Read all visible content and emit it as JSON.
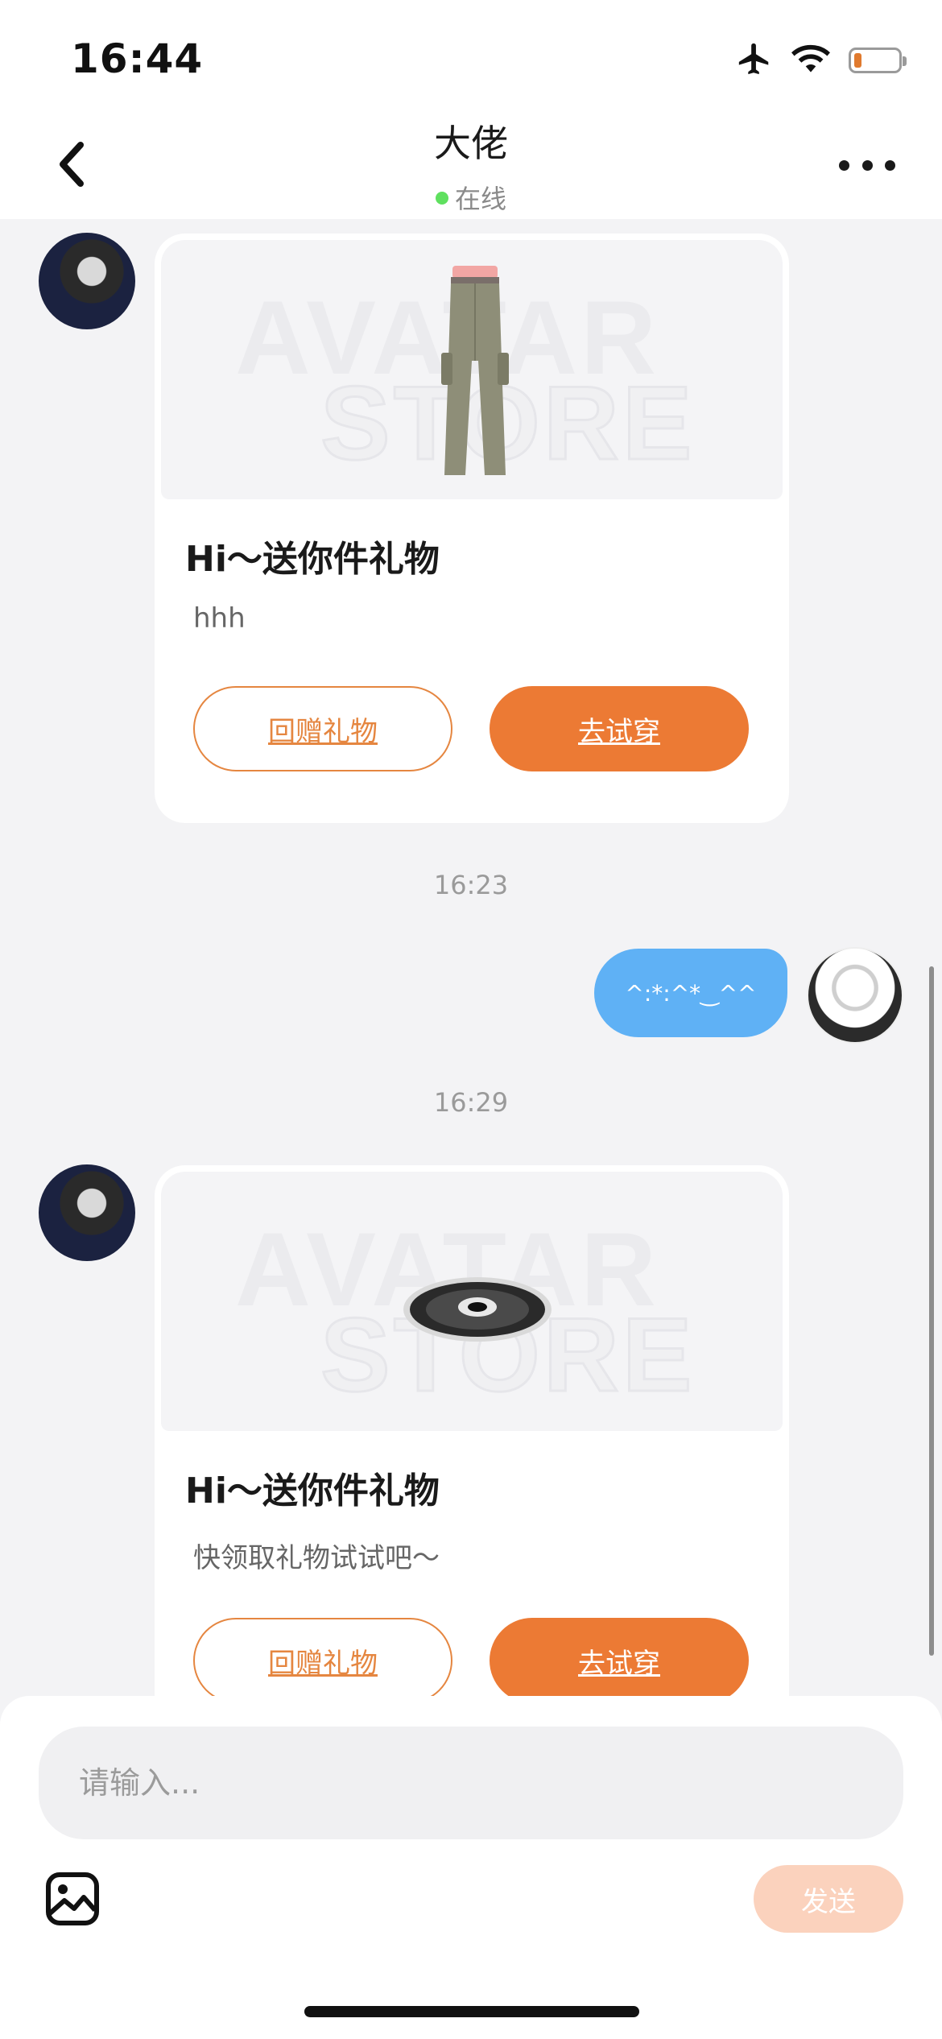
{
  "status_bar": {
    "time": "16:44",
    "battery_level": 0.18
  },
  "header": {
    "title": "大佬",
    "status": "在线"
  },
  "messages": [
    {
      "type": "gift",
      "side": "incoming",
      "title": "Hi～送你件礼物",
      "message": "hhh",
      "return_gift": "回赠礼物",
      "try_on": "去试穿",
      "item": "pants"
    },
    {
      "type": "timestamp",
      "text": "16:23"
    },
    {
      "type": "text",
      "side": "outgoing",
      "text": "^:*:^*‿^^"
    },
    {
      "type": "timestamp",
      "text": "16:29"
    },
    {
      "type": "gift",
      "side": "incoming",
      "title": "Hi～送你件礼物",
      "message": "快领取礼物试试吧～",
      "return_gift": "回赠礼物",
      "try_on": "去试穿",
      "item": "disc"
    }
  ],
  "watermark": {
    "line1": "AVATAR",
    "line2": "STORE"
  },
  "composer": {
    "placeholder": "请输入...",
    "send": "发送"
  },
  "colors": {
    "accent": "#ec7a34",
    "outgoing_bubble": "#5fb1f5",
    "online": "#5fe05f",
    "send_disabled": "#fbd2bd"
  }
}
